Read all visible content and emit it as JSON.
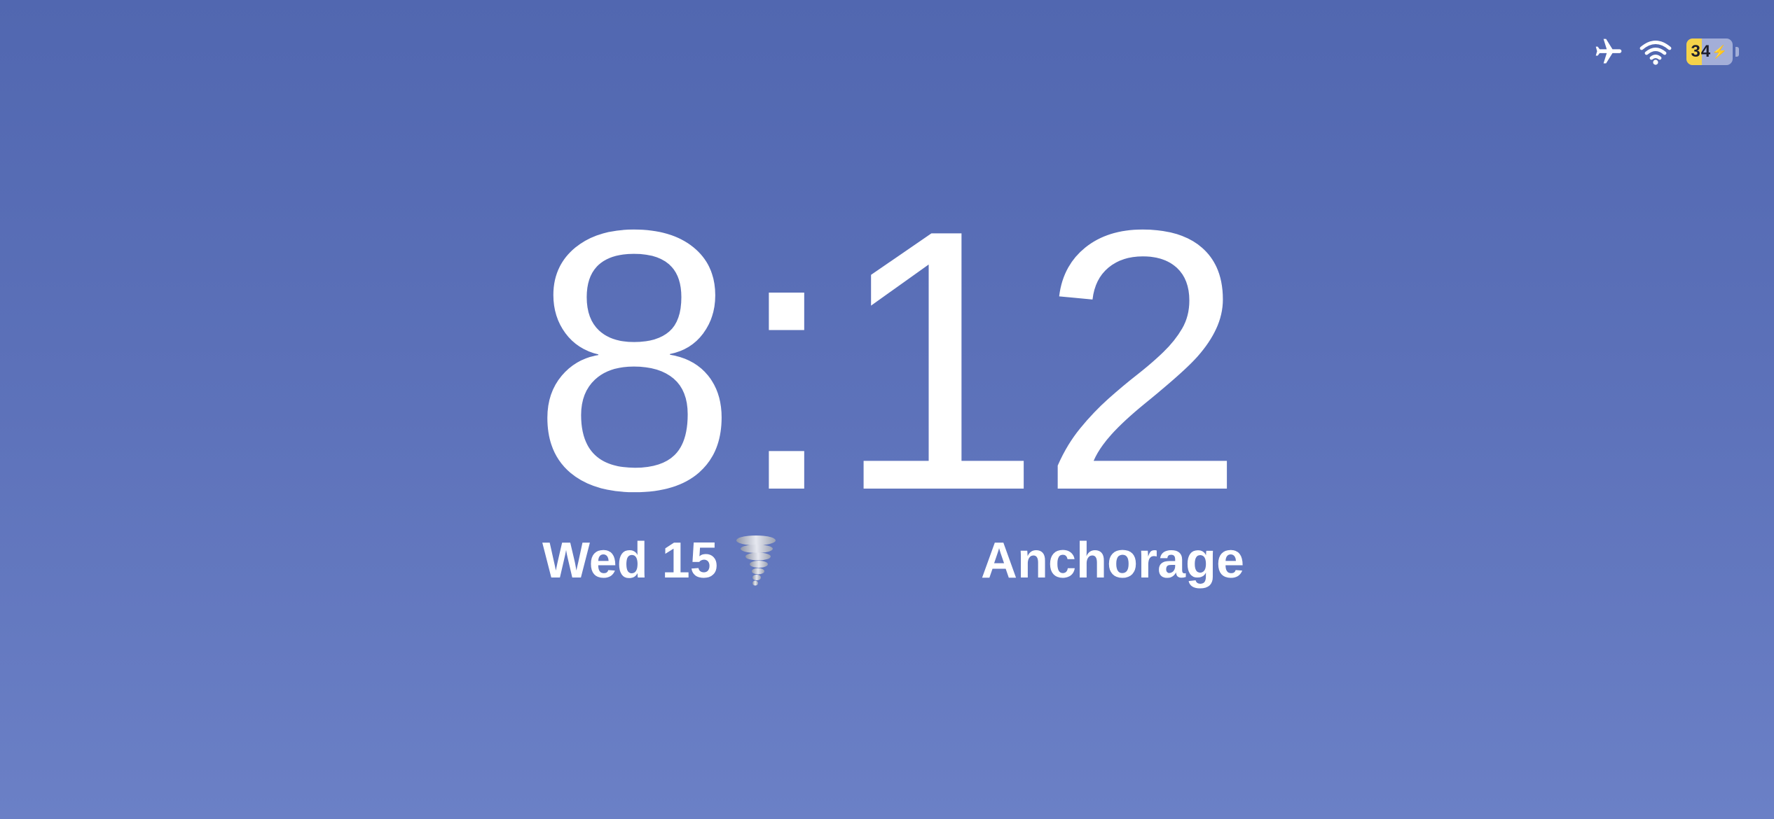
{
  "status_bar": {
    "airplane_icon": "airplane-icon",
    "wifi_icon": "wifi-icon",
    "battery_level": 34,
    "battery_label": "34",
    "battery_charging": true,
    "battery_fill_color": "#f5d24a"
  },
  "clock": {
    "time": "8:12"
  },
  "widgets": {
    "date": "Wed 15",
    "weather_icon": "tornado-icon",
    "location": "Anchorage"
  },
  "colors": {
    "background_top": "#5167b0",
    "background_bottom": "#6b80c6",
    "text": "#ffffff"
  }
}
